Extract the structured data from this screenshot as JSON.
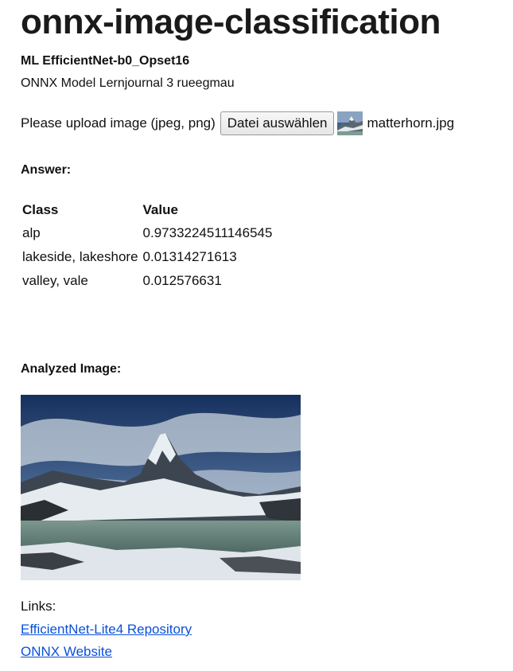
{
  "page": {
    "title": "onnx-image-classification",
    "model_name": "ML EfficientNet-b0_Opset16",
    "subtitle": "ONNX Model Lernjournal 3 rueegmau"
  },
  "upload": {
    "label": "Please upload image (jpeg, png)",
    "button_label": "Datei auswählen",
    "file_name": "matterhorn.jpg"
  },
  "answer": {
    "label": "Answer:",
    "columns": [
      "Class",
      "Value"
    ],
    "rows": [
      {
        "class": "alp",
        "value": "0.9733224511146545"
      },
      {
        "class": "lakeside, lakeshore",
        "value": "0.01314271613"
      },
      {
        "class": "valley, vale",
        "value": "0.012576631"
      }
    ]
  },
  "analyzed": {
    "label": "Analyzed Image:"
  },
  "links": {
    "label": "Links:",
    "items": [
      {
        "text": "EfficientNet-Lite4 Repository"
      },
      {
        "text": "ONNX Website"
      }
    ]
  },
  "colors": {
    "link": "#0a50d8",
    "sky": "#1d3f74",
    "lake": "#6f8f86"
  }
}
